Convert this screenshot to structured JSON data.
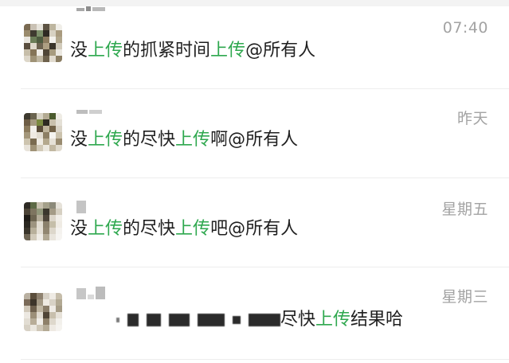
{
  "chats": [
    {
      "time": "07:40",
      "message": {
        "prefix": "没",
        "hl1": "上传",
        "middle": "的抓紧时间",
        "hl2": "上传",
        "suffix": "@所有人"
      }
    },
    {
      "time": "昨天",
      "message": {
        "prefix": "没",
        "hl1": "上传",
        "middle": "的尽快",
        "hl2": "上传",
        "suffix": "啊@所有人"
      }
    },
    {
      "time": "星期五",
      "message": {
        "prefix": "没",
        "hl1": "上传",
        "middle": "的尽快",
        "hl2": "上传",
        "suffix": "吧@所有人"
      }
    },
    {
      "time": "星期三",
      "message": {
        "middle": "尽快",
        "hl1": "上传",
        "suffix": "结果哈"
      }
    }
  ],
  "colors": {
    "highlight": "#2fa84f",
    "time": "#a3a3a3",
    "text": "#1f1f1f",
    "divider": "#ededed"
  },
  "icons": {
    "avatar": "pixelated-avatar"
  }
}
